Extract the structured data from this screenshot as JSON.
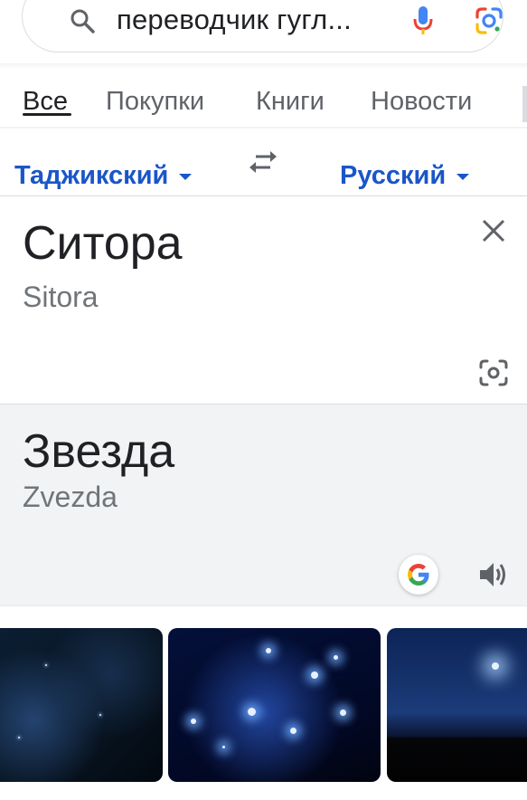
{
  "search": {
    "query": "переводчик гугл..."
  },
  "tabs": [
    {
      "label": "Все",
      "active": true
    },
    {
      "label": "Покупки",
      "active": false
    },
    {
      "label": "Книги",
      "active": false
    },
    {
      "label": "Новости",
      "active": false
    }
  ],
  "translator": {
    "source_language": "Таджикский",
    "target_language": "Русский",
    "source_text": "Ситора",
    "source_transliteration": "Sitora",
    "target_text": "Звезда",
    "target_transliteration": "Zvezda"
  },
  "colors": {
    "accent_blue": "#1a56c8",
    "target_panel_bg": "#f1f3f4",
    "text_primary": "#202124",
    "text_secondary": "#70757a"
  },
  "icons": {
    "search": "search-icon",
    "mic": "mic-icon",
    "lens": "google-lens-icon",
    "swap": "swap-languages-icon",
    "close": "close-icon",
    "camera": "camera-icon",
    "google": "google-logo-icon",
    "speaker": "speaker-icon"
  },
  "images": [
    {
      "name": "night-sky-image"
    },
    {
      "name": "pleiades-star-cluster-image"
    },
    {
      "name": "bright-star-horizon-image"
    }
  ]
}
